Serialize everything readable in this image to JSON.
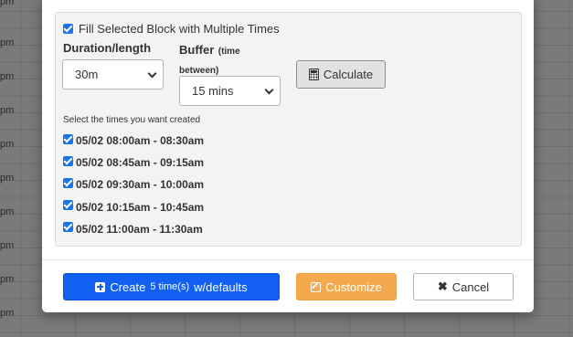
{
  "background": {
    "time_labels": [
      "pm",
      "pm",
      "pm",
      "pm",
      "pm",
      "pm",
      "pm",
      "pm",
      "pm",
      "pm"
    ]
  },
  "modal": {
    "fill_checkbox_label": "Fill Selected Block with Multiple Times",
    "fill_checked": true,
    "duration_label": "Duration/length",
    "duration_value": "30m",
    "buffer_label": "Buffer",
    "buffer_hint": "(time between)",
    "buffer_value": "15 mins",
    "calculate_label": "Calculate",
    "select_times_label": "Select the times you want created",
    "times": [
      {
        "label": "05/02 08:00am - 08:30am",
        "checked": true
      },
      {
        "label": "05/02 08:45am - 09:15am",
        "checked": true
      },
      {
        "label": "05/02 09:30am - 10:00am",
        "checked": true
      },
      {
        "label": "05/02 10:15am - 10:45am",
        "checked": true
      },
      {
        "label": "05/02 11:00am - 11:30am",
        "checked": true
      }
    ],
    "buttons": {
      "create_prefix": "Create",
      "create_count": "5 time(s)",
      "create_suffix": "w/defaults",
      "customize": "Customize",
      "cancel": "Cancel"
    }
  },
  "colors": {
    "primary": "#1160f2",
    "warning": "#f4a94e",
    "checkbox": "#1a73e8"
  },
  "icons": [
    "check-icon",
    "calculator-icon",
    "plus-square-icon",
    "edit-icon",
    "times-icon"
  ]
}
